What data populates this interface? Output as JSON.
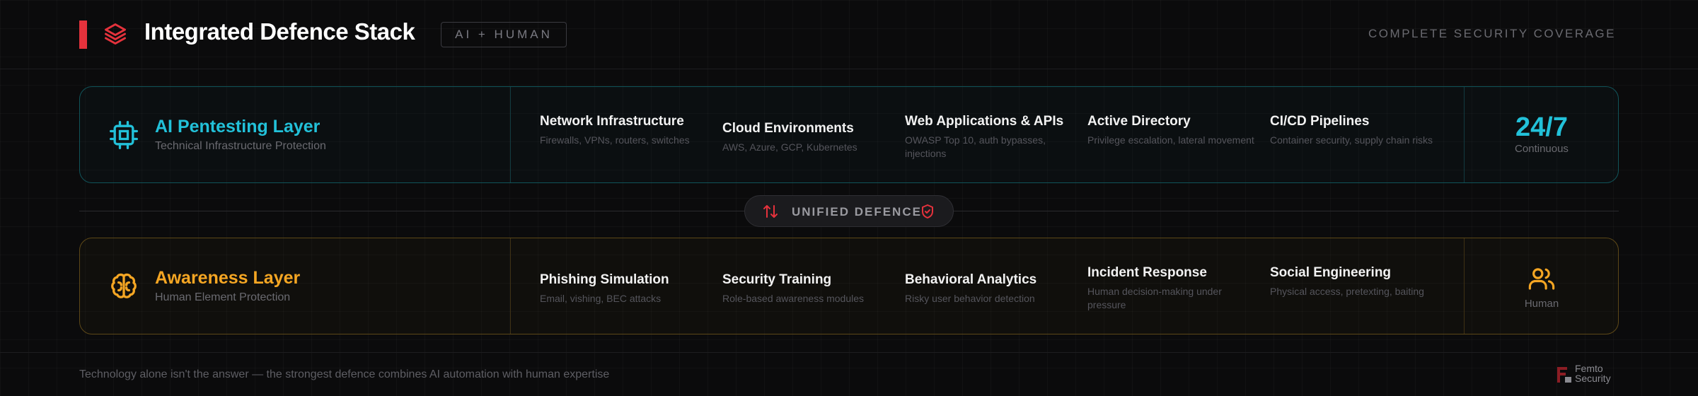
{
  "header": {
    "title": "Integrated Defence Stack",
    "badge": "AI + HUMAN",
    "coverage": "COMPLETE SECURITY COVERAGE",
    "logo_icon": "layers-icon"
  },
  "ai_layer": {
    "title": "AI Pentesting Layer",
    "subtitle": "Technical Infrastructure Protection",
    "icon": "cpu-chip-icon",
    "items": [
      {
        "title": "Network Infrastructure",
        "desc": "Firewalls, VPNs, routers, switches"
      },
      {
        "title": "Cloud Environments",
        "desc": "AWS, Azure, GCP, Kubernetes"
      },
      {
        "title": "Web Applications & APIs",
        "desc": "OWASP Top 10, auth bypasses, injections"
      },
      {
        "title": "Active Directory",
        "desc": "Privilege escalation, lateral movement"
      },
      {
        "title": "CI/CD Pipelines",
        "desc": "Container security, supply chain risks"
      }
    ],
    "stat_value": "24/7",
    "stat_label": "Continuous"
  },
  "connector": {
    "label": "UNIFIED DEFENCE",
    "left_icon": "arrows-up-down-icon",
    "right_icon": "shield-check-icon"
  },
  "awareness_layer": {
    "title": "Awareness Layer",
    "subtitle": "Human Element Protection",
    "icon": "brain-icon",
    "items": [
      {
        "title": "Phishing Simulation",
        "desc": "Email, vishing, BEC attacks"
      },
      {
        "title": "Security Training",
        "desc": "Role-based awareness modules"
      },
      {
        "title": "Behavioral Analytics",
        "desc": "Risky user behavior detection"
      },
      {
        "title": "Incident Response",
        "desc": "Human decision-making under pressure"
      },
      {
        "title": "Social Engineering",
        "desc": "Physical access, pretexting, baiting"
      }
    ],
    "stat_icon": "users-icon",
    "stat_label": "Human"
  },
  "footer": {
    "tagline": "Technology alone isn't the answer — the strongest defence combines AI automation with human expertise",
    "brand_line1": "Femto",
    "brand_line2": "Security"
  },
  "colors": {
    "red_accent": "#e5323c",
    "cyan": "#22c1d9",
    "amber": "#f5a623",
    "background": "#0b0b0c"
  }
}
